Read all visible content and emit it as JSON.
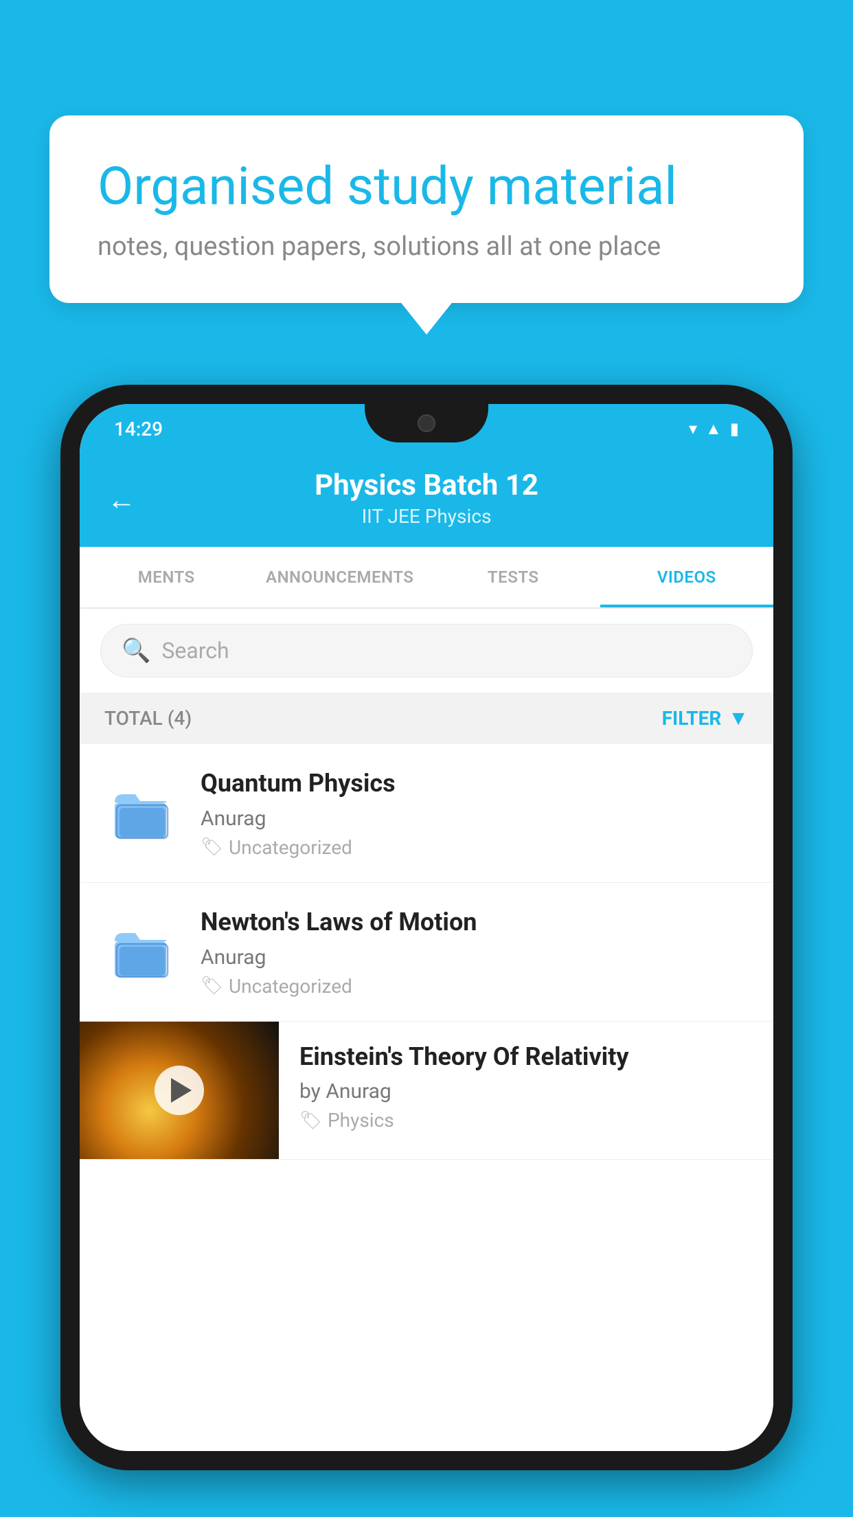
{
  "background_color": "#1ab8e8",
  "speech_bubble": {
    "title": "Organised study material",
    "subtitle": "notes, question papers, solutions all at one place"
  },
  "phone": {
    "status_bar": {
      "time": "14:29",
      "icons": [
        "wifi",
        "signal",
        "battery"
      ]
    },
    "header": {
      "back_label": "←",
      "title": "Physics Batch 12",
      "subtitle": "IIT JEE   Physics"
    },
    "tabs": [
      {
        "label": "MENTS",
        "active": false
      },
      {
        "label": "ANNOUNCEMENTS",
        "active": false
      },
      {
        "label": "TESTS",
        "active": false
      },
      {
        "label": "VIDEOS",
        "active": true
      }
    ],
    "search": {
      "placeholder": "Search"
    },
    "filter_bar": {
      "total_label": "TOTAL (4)",
      "filter_label": "FILTER"
    },
    "videos": [
      {
        "id": 1,
        "title": "Quantum Physics",
        "author": "Anurag",
        "tag": "Uncategorized",
        "type": "folder"
      },
      {
        "id": 2,
        "title": "Newton's Laws of Motion",
        "author": "Anurag",
        "tag": "Uncategorized",
        "type": "folder"
      },
      {
        "id": 3,
        "title": "Einstein's Theory Of Relativity",
        "author": "by Anurag",
        "tag": "Physics",
        "type": "video"
      }
    ]
  }
}
